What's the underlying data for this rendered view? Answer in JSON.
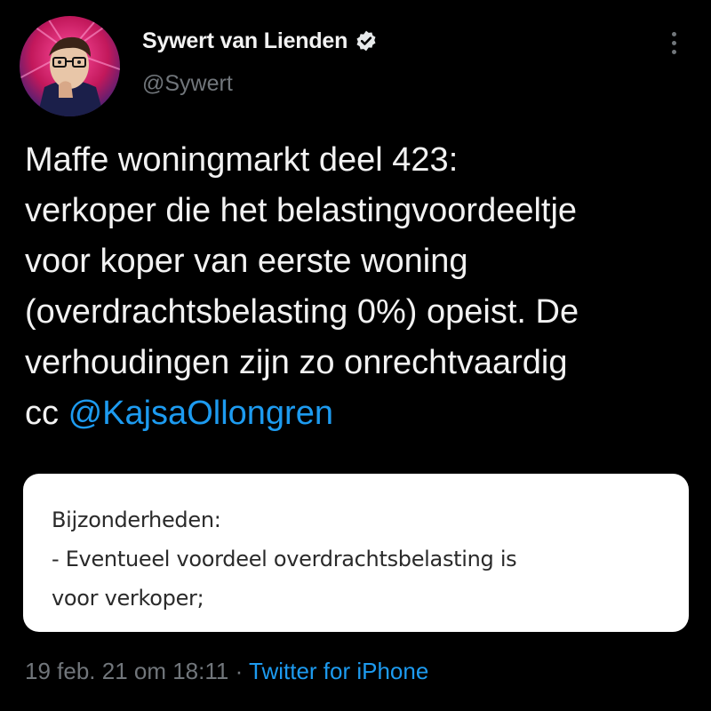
{
  "author": {
    "display_name": "Sywert van Lienden",
    "handle": "@Sywert",
    "verified": true,
    "avatar": "avatar-portrait-illustration"
  },
  "tweet": {
    "lines": [
      "Maffe woningmarkt deel 423:",
      "verkoper die het belastingvoordeeltje",
      "voor koper van eerste woning",
      "(overdrachtsbelasting 0%) opeist. De",
      "verhoudingen zijn zo onrechtvaardig"
    ],
    "cc_prefix": "cc ",
    "mention": "@KajsaOllongren"
  },
  "media": {
    "lines": [
      "Bijzonderheden:",
      "- Eventueel voordeel overdrachtsbelasting is",
      "voor verkoper;"
    ]
  },
  "meta": {
    "timestamp": "19 feb. 21 om 18:11",
    "separator": " · ",
    "source": "Twitter for iPhone"
  },
  "icons": {
    "verified": "verified-badge-icon",
    "more": "more-options-icon"
  },
  "colors": {
    "background": "#000000",
    "text": "#f2f2f2",
    "secondary": "#71767b",
    "link": "#1d9bf0"
  }
}
